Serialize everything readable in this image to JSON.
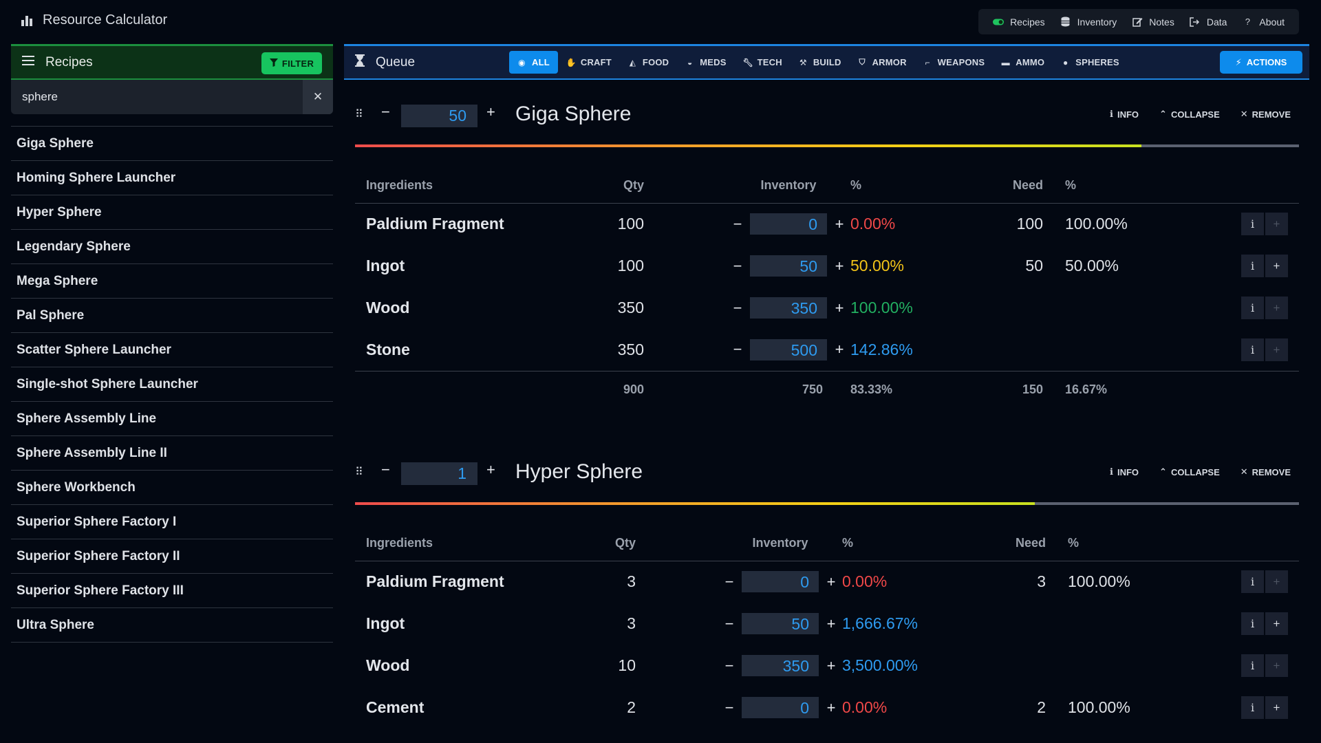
{
  "app": {
    "title": "Resource Calculator"
  },
  "topnav": [
    {
      "label": "Recipes",
      "icon": "toggle-icon"
    },
    {
      "label": "Inventory",
      "icon": "database-icon"
    },
    {
      "label": "Notes",
      "icon": "edit-icon"
    },
    {
      "label": "Data",
      "icon": "export-icon"
    },
    {
      "label": "About",
      "icon": "question-icon"
    }
  ],
  "sidebar": {
    "title": "Recipes",
    "filter_label": "FILTER",
    "search_value": "sphere",
    "items": [
      "Giga Sphere",
      "Homing Sphere Launcher",
      "Hyper Sphere",
      "Legendary Sphere",
      "Mega Sphere",
      "Pal Sphere",
      "Scatter Sphere Launcher",
      "Single-shot Sphere Launcher",
      "Sphere Assembly Line",
      "Sphere Assembly Line II",
      "Sphere Workbench",
      "Superior Sphere Factory I",
      "Superior Sphere Factory II",
      "Superior Sphere Factory III",
      "Ultra Sphere"
    ]
  },
  "queue": {
    "title": "Queue",
    "actions_label": "ACTIONS",
    "tabs": [
      "ALL",
      "CRAFT",
      "FOOD",
      "MEDS",
      "TECH",
      "BUILD",
      "ARMOR",
      "WEAPONS",
      "AMMO",
      "SPHERES"
    ],
    "active_tab": "ALL"
  },
  "card_labels": {
    "info": "INFO",
    "collapse": "COLLAPSE",
    "remove": "REMOVE",
    "col_ingredients": "Ingredients",
    "col_qty": "Qty",
    "col_inventory": "Inventory",
    "col_pct": "%",
    "col_need": "Need",
    "col_pct2": "%"
  },
  "cards": [
    {
      "title": "Giga Sphere",
      "quantity": "50",
      "progress": 0.8333,
      "ingredients": [
        {
          "name": "Paldium Fragment",
          "qty": "100",
          "inventory": "0",
          "pct": "0.00%",
          "pct_color": "red",
          "need": "100",
          "need_pct": "100.00%"
        },
        {
          "name": "Ingot",
          "qty": "100",
          "inventory": "50",
          "pct": "50.00%",
          "pct_color": "yellow",
          "need": "50",
          "need_pct": "50.00%"
        },
        {
          "name": "Wood",
          "qty": "350",
          "inventory": "350",
          "pct": "100.00%",
          "pct_color": "green",
          "need": "",
          "need_pct": ""
        },
        {
          "name": "Stone",
          "qty": "350",
          "inventory": "500",
          "pct": "142.86%",
          "pct_color": "blue",
          "need": "",
          "need_pct": ""
        }
      ],
      "totals": {
        "qty": "900",
        "inventory": "750",
        "pct": "83.33%",
        "need": "150",
        "need_pct": "16.67%"
      }
    },
    {
      "title": "Hyper Sphere",
      "quantity": "1",
      "progress": 0.72,
      "ingredients": [
        {
          "name": "Paldium Fragment",
          "qty": "3",
          "inventory": "0",
          "pct": "0.00%",
          "pct_color": "red",
          "need": "3",
          "need_pct": "100.00%"
        },
        {
          "name": "Ingot",
          "qty": "3",
          "inventory": "50",
          "pct": "1,666.67%",
          "pct_color": "blue",
          "need": "",
          "need_pct": ""
        },
        {
          "name": "Wood",
          "qty": "10",
          "inventory": "350",
          "pct": "3,500.00%",
          "pct_color": "blue",
          "need": "",
          "need_pct": ""
        },
        {
          "name": "Cement",
          "qty": "2",
          "inventory": "0",
          "pct": "0.00%",
          "pct_color": "red",
          "need": "2",
          "need_pct": "100.00%"
        }
      ]
    }
  ]
}
